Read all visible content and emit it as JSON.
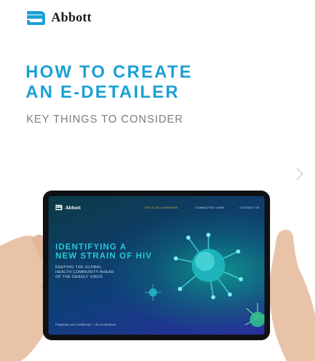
{
  "brand": {
    "name": "Abbott"
  },
  "header": {
    "title_line1": "HOW TO CREATE",
    "title_line2": "AN E-DETAILER",
    "subtitle": "KEY THINGS TO CONSIDER"
  },
  "nav": {
    "next_icon": "chevron-right-icon"
  },
  "tablet": {
    "brand": "Abbott",
    "nav_items": [
      "THE GLAS CHANGERS",
      "CONNECTED CARE",
      "CONTACT US"
    ],
    "headline_line1": "IDENTIFYING A",
    "headline_line2": "NEW STRAIN OF HIV",
    "sub_line1": "KEEPING THE GLOBAL",
    "sub_line2": "HEALTH COMMUNITY AHEAD",
    "sub_line3": "OF THE DEADLY VIRUS",
    "footer": "Proprietary and confidential — do not distribute"
  },
  "colors": {
    "accent": "#1aa0d6",
    "subtitle": "#7d7d7d",
    "screen_headline": "#29c9d8",
    "nav_active": "#e6c24a"
  }
}
